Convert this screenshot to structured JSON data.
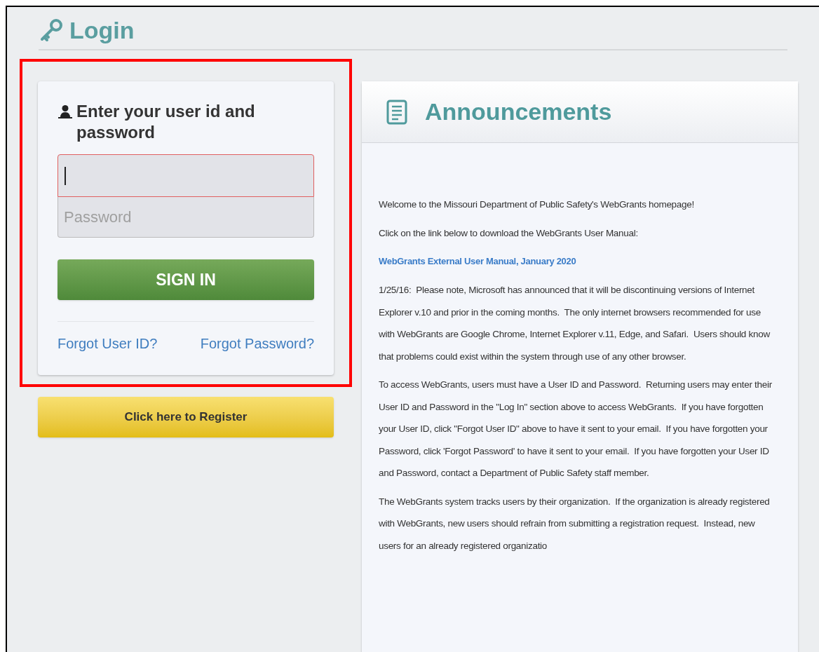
{
  "page_title": "Login",
  "login_card": {
    "heading": "Enter your user id and password",
    "user_id_field": {
      "focused": true
    },
    "password_field": {
      "placeholder": "Password"
    },
    "sign_in_button": "SIGN IN",
    "links": [
      "Forgot User ID?",
      "Forgot Password?"
    ]
  },
  "register_button": "Click here to Register",
  "announcements": {
    "title": "Announcements",
    "paragraphs": [
      {
        "kind": "text",
        "text": "Welcome to the Missouri Department of Public Safety's WebGrants homepage!"
      },
      {
        "kind": "text",
        "text": "Click on the link below to download the WebGrants User Manual:"
      },
      {
        "kind": "link",
        "text": "WebGrants External User Manual, January 2020"
      },
      {
        "kind": "text",
        "text": "1/25/16:  Please note, Microsoft has announced that it will be discontinuing versions of Internet Explorer v.10 and prior in the coming months.  The only internet browsers recommended for use with WebGrants are Google Chrome, Internet Explorer v.11, Edge, and Safari.  Users should know that problems could exist within the system through use of any other browser."
      },
      {
        "kind": "text",
        "text": "To access WebGrants, users must have a User ID and Password.  Returning users may enter their User ID and Password in the \"Log In\" section above to access WebGrants.  If you have forgotten your User ID, click \"Forgot User ID\" above to have it sent to your email.  If you have forgotten your Password, click 'Forgot Password' to have it sent to your email.  If you have forgotten your User ID and Password, contact a Department of Public Safety staff member."
      },
      {
        "kind": "text",
        "text": "The WebGrants system tracks users by their organization.  If the organization is already registered with WebGrants, new users should refrain from submitting a registration request.  Instead, new users for an already registered organizatio"
      }
    ]
  }
}
